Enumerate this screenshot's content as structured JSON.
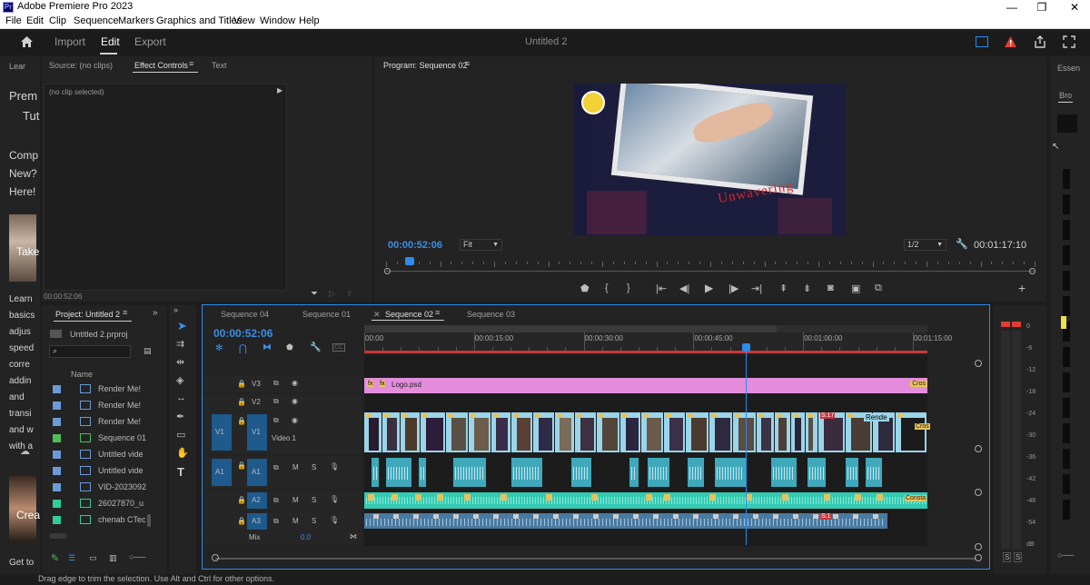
{
  "app": {
    "title": "Adobe Premiere Pro 2023",
    "icon_label": "Pr"
  },
  "window_controls": [
    "minimize-icon",
    "restore-icon",
    "close-icon"
  ],
  "menu": [
    "File",
    "Edit",
    "Clip",
    "Sequence",
    "Markers",
    "Graphics and Titles",
    "View",
    "Window",
    "Help"
  ],
  "header": {
    "workspaces": [
      {
        "label": "Import",
        "active": false
      },
      {
        "label": "Edit",
        "active": true
      },
      {
        "label": "Export",
        "active": false
      }
    ],
    "project_title": "Untitled 2"
  },
  "learn": {
    "tab": "Lear",
    "lines": [
      "Prem",
      "Tut",
      "Comp",
      "New?",
      "Here!",
      "Take",
      "Learn",
      "basics",
      "adjus",
      "speed",
      "corre",
      "addin",
      "and",
      "transi",
      "and w",
      "with a",
      "Crea",
      "Get to"
    ]
  },
  "source_panel": {
    "tabs": [
      {
        "label": "Source: (no clips)",
        "active": false
      },
      {
        "label": "Effect Controls",
        "active": true
      },
      {
        "label": "Text",
        "active": false
      }
    ],
    "no_clip": "(no clip selected)",
    "timecode": "00:00:52:06"
  },
  "program": {
    "title": "Program: Sequence 02",
    "timecode": "00:00:52:06",
    "fit": "Fit",
    "resolution": "1/2",
    "duration": "00:01:17:10",
    "overlay_text": "Unwavering",
    "playhead_fraction": 0.03
  },
  "project": {
    "title": "Project: Untitled 2",
    "file": "Untitled 2.prproj",
    "col_name": "Name",
    "items": [
      {
        "label": "Render Me!",
        "swatch": "#6a9bd8"
      },
      {
        "label": "Render Me!",
        "swatch": "#6a9bd8"
      },
      {
        "label": "Render Me!",
        "swatch": "#6a9bd8"
      },
      {
        "label": "Sequence 01",
        "swatch": "#4fbf5a"
      },
      {
        "label": "Untitled vide",
        "swatch": "#6a9bd8"
      },
      {
        "label": "Untitled vide",
        "swatch": "#6a9bd8"
      },
      {
        "label": "VID-2023092",
        "swatch": "#6a9bd8"
      },
      {
        "label": "26027870_u",
        "swatch": "#33cc99"
      },
      {
        "label": "chenab CTec",
        "swatch": "#33cc99"
      }
    ]
  },
  "timeline": {
    "tabs": [
      {
        "label": "Sequence 04",
        "active": false
      },
      {
        "label": "Sequence 01",
        "active": false
      },
      {
        "label": "Sequence 02",
        "active": true
      },
      {
        "label": "Sequence 03",
        "active": false
      }
    ],
    "timecode": "00:00:52:06",
    "ruler": [
      "00:00",
      "00:00:15:00",
      "00:00:30:00",
      "00:00:45:00",
      "00:01:00:00",
      "00:01:15:00"
    ],
    "playhead_seconds": 52.2,
    "ruler_span_seconds": 77,
    "tracks": {
      "v3": "V3",
      "v2": "V2",
      "v1": "V1",
      "v1_src": "V1",
      "v1_name": "Video 1",
      "a1": "A1",
      "a1_src": "A1",
      "a2": "A2",
      "a3": "A3",
      "mix": "Mix",
      "mix_value": "0.0"
    },
    "logo_clip": "Logo.psd",
    "logo_end": "Cros",
    "v1_label": "Rende",
    "v1_end": "Cros",
    "v1_badge": "S:17",
    "a2_end": "Consta",
    "a3_badge": "S:1",
    "m_label": "M",
    "s_label": "S",
    "fx": "fx"
  },
  "meters": {
    "scale": [
      "0",
      "-6",
      "-12",
      "-18",
      "-24",
      "-30",
      "-36",
      "-42",
      "-48",
      "-54",
      "dB"
    ],
    "solo": [
      "S",
      "S"
    ]
  },
  "essentials": {
    "tab": "Essen",
    "sub": "Bro"
  },
  "status": "Drag edge to trim the selection. Use Alt and Ctrl for other options.",
  "colors": {
    "accent": "#2d8ceb",
    "timecode": "#3d8fe4",
    "video_clip": "#9ad5ea",
    "audio_clip": "#3fa9bb",
    "graphic_clip": "#e48ddc",
    "alert": "#e03c31"
  }
}
